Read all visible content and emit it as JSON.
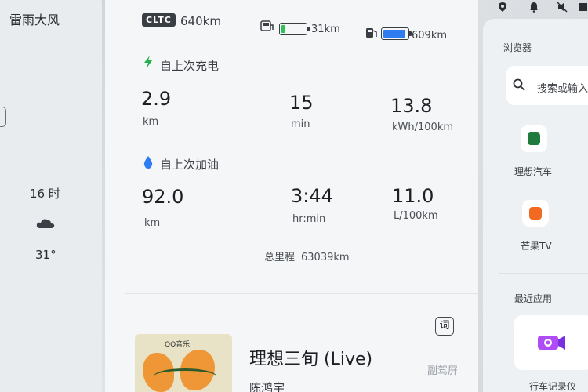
{
  "weather": {
    "condition": "雷雨大风",
    "hour": "16 时",
    "temperature": "31°",
    "icon": "cloud-icon"
  },
  "range": {
    "cltc_badge": "CLTC",
    "cltc_value": "640km",
    "ev_range": "31km",
    "fuel_range": "609km",
    "ev_battery_color": "#2fbf5b",
    "fuel_level_color": "#2d7cf0"
  },
  "since_charge": {
    "title": "自上次充电",
    "icon": "lightning-icon",
    "stats": [
      {
        "value": "2.9",
        "unit": "km"
      },
      {
        "value": "15",
        "unit": "min"
      },
      {
        "value": "13.8",
        "unit": "kWh/100km"
      }
    ]
  },
  "since_refuel": {
    "title": "自上次加油",
    "icon": "fuel-drop-icon",
    "stats": [
      {
        "value": "92.0",
        "unit": "km"
      },
      {
        "value": "3:44",
        "unit": "hr:min"
      },
      {
        "value": "11.0",
        "unit": "L/100km"
      }
    ]
  },
  "odometer": {
    "label": "总里程",
    "value": "63039km"
  },
  "music": {
    "lyrics_button": "词",
    "album_logo": "QQ音乐",
    "song_title": "理想三旬 (Live)",
    "artist": "陈鸿宇",
    "copilot_screen": "副驾屏"
  },
  "sidebar": {
    "browser_label": "浏览器",
    "search_placeholder": "搜索或输入网址",
    "apps": [
      {
        "label": "理想汽车",
        "icon": "li-auto-icon",
        "color": "#1f7a3d"
      },
      {
        "label": "芒果TV",
        "icon": "mango-tv-icon",
        "color": "#f26a21"
      }
    ],
    "recent_label": "最近应用",
    "recent_apps": [
      {
        "label": "行车记录仪",
        "icon": "dashcam-icon",
        "color": "#9b3df0"
      }
    ]
  }
}
